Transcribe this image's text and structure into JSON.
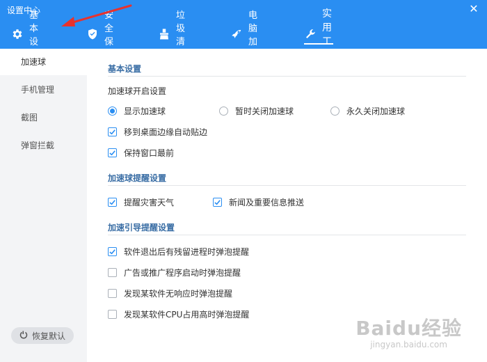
{
  "window": {
    "title": "设置中心",
    "close_glyph": "✕"
  },
  "tabs": [
    {
      "label": "基本设置",
      "icon": "gear-icon",
      "active": false
    },
    {
      "label": "安全保护",
      "icon": "shield-icon",
      "active": false
    },
    {
      "label": "垃圾清理",
      "icon": "broom-icon",
      "active": false
    },
    {
      "label": "电脑加速",
      "icon": "rocket-icon",
      "active": false
    },
    {
      "label": "实用工具",
      "icon": "wrench-icon",
      "active": true
    }
  ],
  "sidebar": {
    "items": [
      {
        "label": "加速球",
        "active": true
      },
      {
        "label": "手机管理",
        "active": false
      },
      {
        "label": "截图",
        "active": false
      },
      {
        "label": "弹窗拦截",
        "active": false
      }
    ],
    "restore_label": "恢复默认"
  },
  "sections": {
    "basic": {
      "title": "基本设置",
      "open_label": "加速球开启设置",
      "radios": [
        {
          "label": "显示加速球",
          "checked": true
        },
        {
          "label": "暂时关闭加速球",
          "checked": false
        },
        {
          "label": "永久关闭加速球",
          "checked": false
        }
      ],
      "checkboxes": [
        {
          "label": "移到桌面边缘自动贴边",
          "checked": true
        },
        {
          "label": "保持窗口最前",
          "checked": true
        }
      ]
    },
    "remind": {
      "title": "加速球提醒设置",
      "checkboxes": [
        {
          "label": "提醒灾害天气",
          "checked": true
        },
        {
          "label": "新闻及重要信息推送",
          "checked": true
        }
      ]
    },
    "guide": {
      "title": "加速引导提醒设置",
      "checkboxes": [
        {
          "label": "软件退出后有残留进程时弹泡提醒",
          "checked": true
        },
        {
          "label": "广告或推广程序启动时弹泡提醒",
          "checked": false
        },
        {
          "label": "发现某软件无响应时弹泡提醒",
          "checked": false
        },
        {
          "label": "发现某软件CPU占用高时弹泡提醒",
          "checked": false
        }
      ]
    }
  },
  "watermark": {
    "brand": "Baidu经验",
    "url": "jingyan.baidu.com"
  },
  "colors": {
    "accent": "#2a8ef2",
    "section_title": "#3a6ea5",
    "annotation_arrow": "#e8322d"
  }
}
